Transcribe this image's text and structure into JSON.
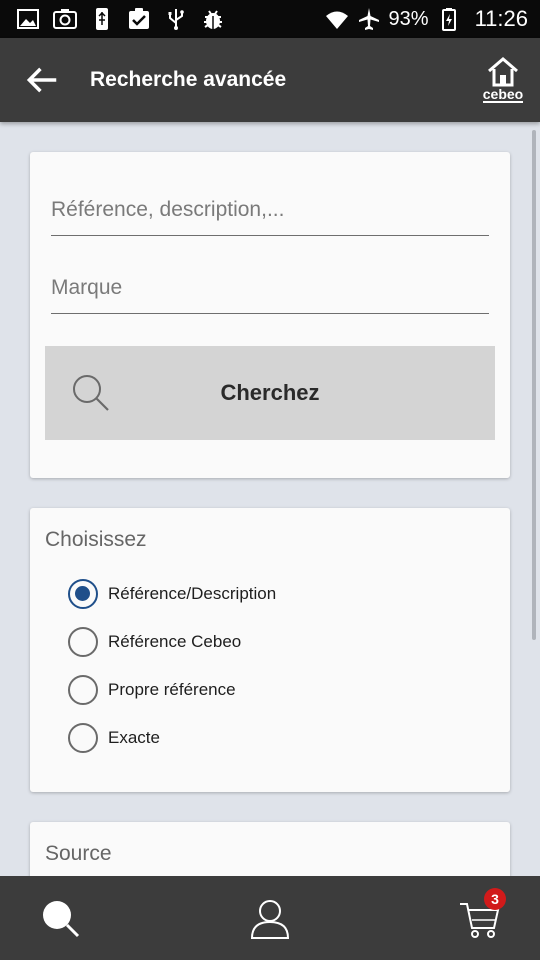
{
  "status_bar": {
    "icons": [
      "image-icon",
      "camera-icon",
      "usb-icon",
      "clipboard-check-icon",
      "usb-symbol-icon",
      "bug-icon"
    ],
    "battery_percent": "93%",
    "time": "11:26"
  },
  "app_bar": {
    "title": "Recherche avancée",
    "logo_text": "cebeo"
  },
  "search_card": {
    "reference_placeholder": "Référence, description,...",
    "brand_placeholder": "Marque",
    "search_button_label": "Cherchez"
  },
  "choose_card": {
    "heading": "Choisissez",
    "options": [
      {
        "label": "Référence/Description",
        "checked": true
      },
      {
        "label": "Référence Cebeo",
        "checked": false
      },
      {
        "label": "Propre référence",
        "checked": false
      },
      {
        "label": "Exacte",
        "checked": false
      }
    ]
  },
  "source_card": {
    "heading": "Source"
  },
  "bottom_nav": {
    "cart_count": "3"
  },
  "colors": {
    "app_bar": "#3c3c3c",
    "accent": "#1f4f8a",
    "badge": "#d11a1a",
    "background": "#dfe3ea"
  }
}
